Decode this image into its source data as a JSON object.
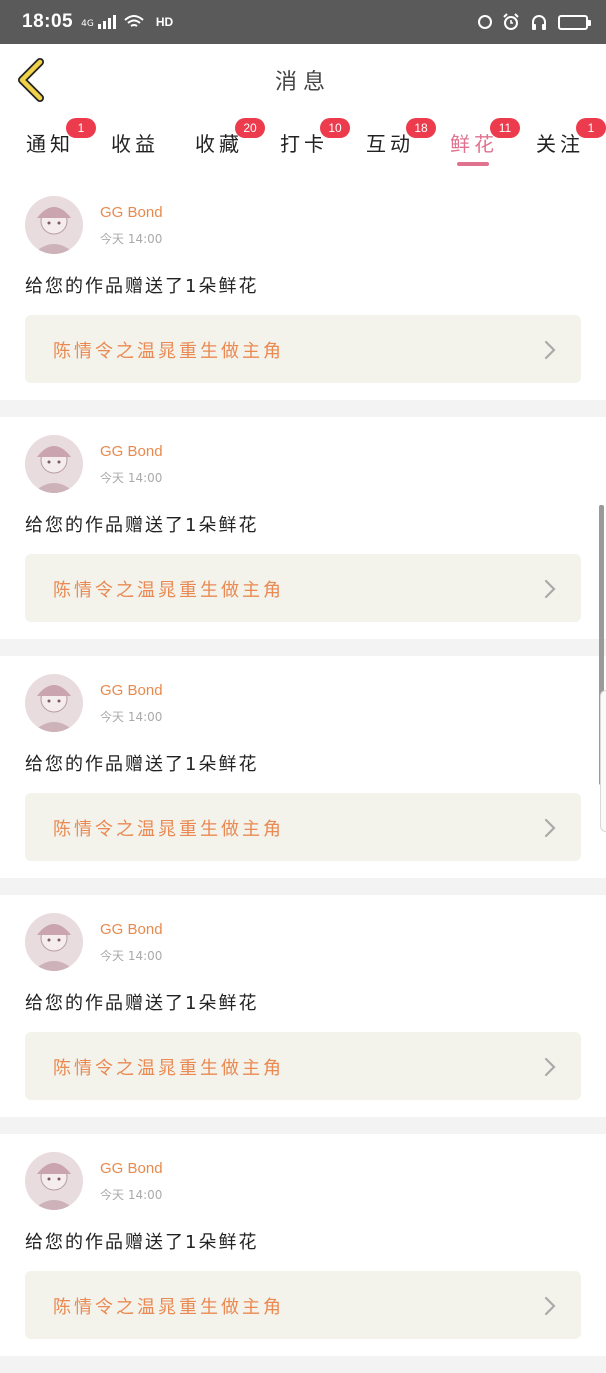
{
  "status_bar": {
    "time": "18:05",
    "network": "4G",
    "hd": "HD"
  },
  "header": {
    "title": "消息"
  },
  "tabs": [
    {
      "label": "通知",
      "badge": "1",
      "active": false
    },
    {
      "label": "收益",
      "badge": "",
      "active": false
    },
    {
      "label": "收藏",
      "badge": "20",
      "active": false
    },
    {
      "label": "打卡",
      "badge": "10",
      "active": false
    },
    {
      "label": "互动",
      "badge": "18",
      "active": false
    },
    {
      "label": "鲜花",
      "badge": "11",
      "active": true
    },
    {
      "label": "关注",
      "badge": "1",
      "active": false
    }
  ],
  "messages": [
    {
      "username": "GG Bond",
      "time": "今天 14:00",
      "text": "给您的作品赠送了1朵鲜花",
      "work_title": "陈情令之温晁重生做主角"
    },
    {
      "username": "GG Bond",
      "time": "今天 14:00",
      "text": "给您的作品赠送了1朵鲜花",
      "work_title": "陈情令之温晁重生做主角"
    },
    {
      "username": "GG Bond",
      "time": "今天 14:00",
      "text": "给您的作品赠送了1朵鲜花",
      "work_title": "陈情令之温晁重生做主角"
    },
    {
      "username": "GG Bond",
      "time": "今天 14:00",
      "text": "给您的作品赠送了1朵鲜花",
      "work_title": "陈情令之温晁重生做主角"
    },
    {
      "username": "GG Bond",
      "time": "今天 14:00",
      "text": "给您的作品赠送了1朵鲜花",
      "work_title": "陈情令之温晁重生做主角"
    }
  ],
  "colors": {
    "accent": "#e0728f",
    "badge": "#ec3b4d",
    "username": "#e88a4e",
    "work_title": "#ea8a52",
    "back_icon": "#f0d24a"
  }
}
